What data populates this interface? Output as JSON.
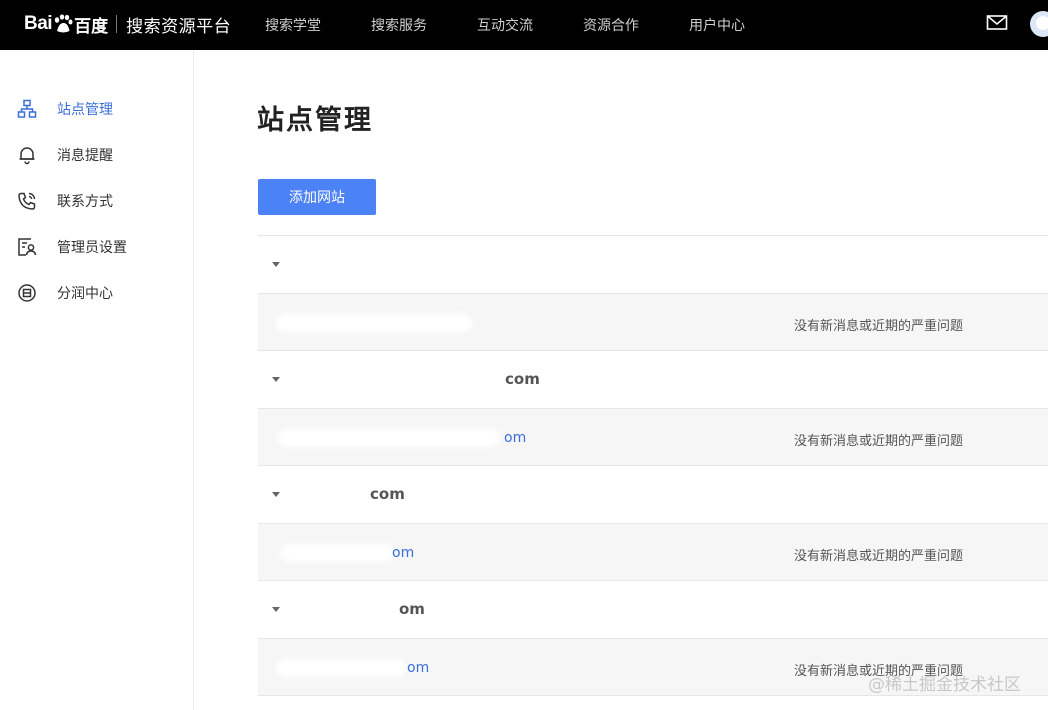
{
  "header": {
    "logo_text": "Bai",
    "logo_du": "百度",
    "platform_name": "搜索资源平台",
    "nav": [
      "搜索学堂",
      "搜索服务",
      "互动交流",
      "资源合作",
      "用户中心"
    ],
    "icons": [
      "mail-icon",
      "avatar"
    ]
  },
  "sidebar": {
    "items": [
      {
        "label": "站点管理",
        "icon": "sitemap-icon",
        "active": true
      },
      {
        "label": "消息提醒",
        "icon": "bell-icon",
        "active": false
      },
      {
        "label": "联系方式",
        "icon": "phone-icon",
        "active": false
      },
      {
        "label": "管理员设置",
        "icon": "admin-icon",
        "active": false
      },
      {
        "label": "分润中心",
        "icon": "revenue-icon",
        "active": false
      }
    ]
  },
  "main": {
    "title": "站点管理",
    "add_button": "添加网站",
    "sites": [
      {
        "name": "",
        "sub_link": "",
        "status": "没有新消息或近期的严重问题"
      },
      {
        "name": "com",
        "sub_link": "om",
        "status": "没有新消息或近期的严重问题"
      },
      {
        "name": "com",
        "sub_link": "om",
        "status": "没有新消息或近期的严重问题"
      },
      {
        "name": "om",
        "sub_link": "om",
        "status": "没有新消息或近期的严重问题"
      }
    ]
  },
  "watermark": "@稀土掘金技术社区",
  "colors": {
    "accent": "#4b82f5",
    "link": "#3a6fd8",
    "topbar": "#000000"
  }
}
